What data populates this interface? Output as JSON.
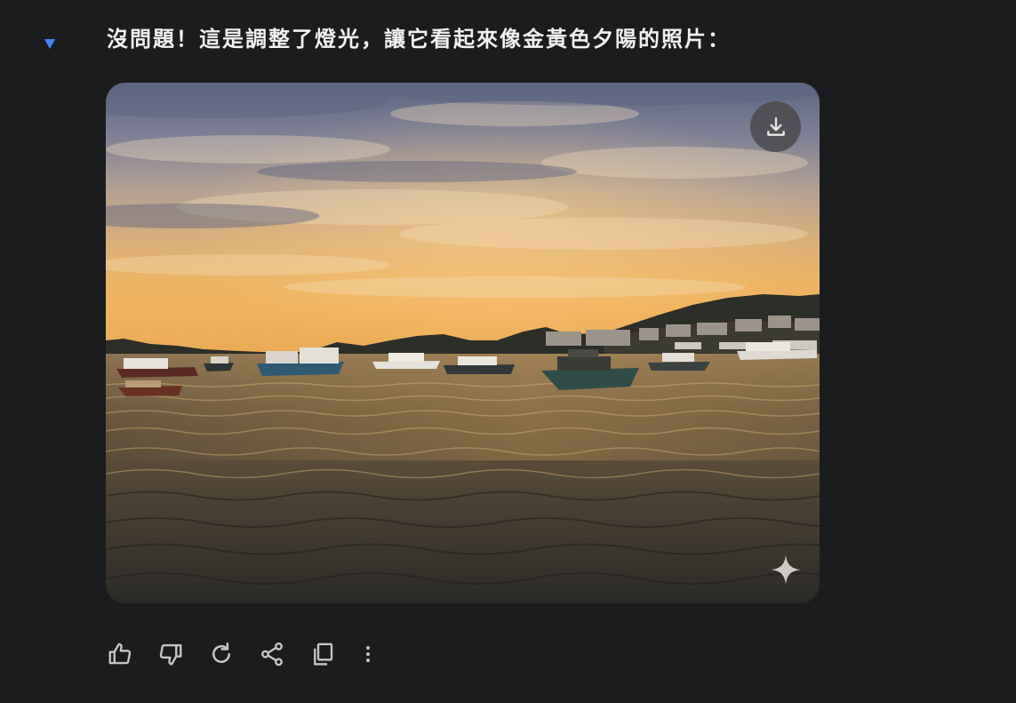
{
  "conversation": {
    "response_text": "沒問題！這是調整了燈光，讓它看起來像金黃色夕陽的照片："
  },
  "image": {
    "subject": "harbor-sunset-photo",
    "colors": {
      "sky_top": "#6f7590",
      "sky_bottom": "#e8aa58",
      "water": "#3a342b",
      "hills": "#2c2f27"
    }
  },
  "image_overlay": {
    "download_icon": "download-icon",
    "watermark_icon": "sparkle-icon"
  },
  "actions": [
    {
      "name": "thumbs-up-icon"
    },
    {
      "name": "thumbs-down-icon"
    },
    {
      "name": "regenerate-icon"
    },
    {
      "name": "share-icon"
    },
    {
      "name": "copy-icon"
    },
    {
      "name": "more-options-icon"
    }
  ],
  "theme": {
    "background": "#1b1c1e",
    "icon_color": "#c4c7c5",
    "accent": "#4285f4"
  }
}
